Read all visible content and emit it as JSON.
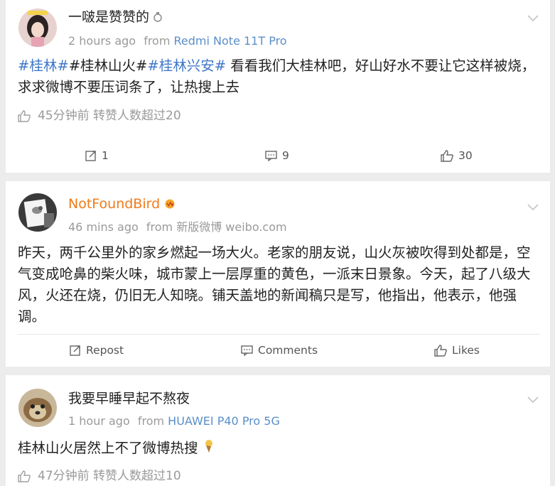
{
  "posts": [
    {
      "author": "一啵是赞赞的",
      "time": "2 hours ago",
      "from_label": "from",
      "device": "Redmi Note 11T Pro",
      "tags": [
        "#桂林#",
        "#桂林山火#",
        "#桂林兴安#"
      ],
      "text": " 看看我们大桂林吧，好山好水不要让它这样被烧，求求微博不要压词条了，让热搜上去",
      "like_info": "45分钟前 转赞人数超过20",
      "repost_count": "1",
      "comment_count": "9",
      "like_count": "30"
    },
    {
      "author": "NotFoundBird",
      "time": "46 mins ago",
      "from_label": "from",
      "device": "新版微博 weibo.com",
      "text": "昨天，两千公里外的家乡燃起一场大火。老家的朋友说，山火灰被吹得到处都是，空气变成呛鼻的柴火味，城市蒙上一层厚重的黄色，一派末日景象。今天，起了八级大风，火还在烧，仍旧无人知晓。铺天盖地的新闻稿只是写，他指出，他表示，他强调。",
      "repost_label": "Repost",
      "comment_label": "Comments",
      "like_label": "Likes"
    },
    {
      "author": "我要早睡早起不熬夜",
      "time": "1 hour ago",
      "from_label": "from",
      "device": "HUAWEI P40 Pro 5G",
      "text": "桂林山火居然上不了微博热搜",
      "like_info": "47分钟前 转赞人数超过10"
    }
  ],
  "icons": {
    "chevron": "chevron-down-icon",
    "like": "thumbs-up-icon",
    "repost": "repost-icon",
    "comment": "comment-icon"
  },
  "colors": {
    "link": "#3f77c9",
    "device": "#5a8fc8",
    "orange_name": "#f07a1a",
    "meta_gray": "#9a9a9a"
  }
}
